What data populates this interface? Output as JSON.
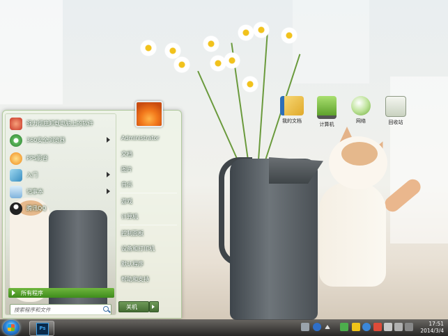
{
  "start_menu": {
    "programs": [
      {
        "label": "强力彻底卸载电脑上的软件",
        "icon": "uninstall-icon",
        "color": "#d9534f",
        "has_arrow": false
      },
      {
        "label": "360安全浏览器",
        "icon": "browser-360-icon",
        "color": "#5cb85c",
        "has_arrow": true
      },
      {
        "label": "PPS影音",
        "icon": "pps-icon",
        "color": "#f0ad4e",
        "has_arrow": false
      },
      {
        "label": "入门",
        "icon": "getting-started-icon",
        "color": "#5bc0de",
        "has_arrow": true
      },
      {
        "label": "记事本",
        "icon": "notepad-icon",
        "color": "#6fa8dc",
        "has_arrow": true
      },
      {
        "label": "腾讯QQ",
        "icon": "qq-icon",
        "color": "#333333",
        "has_arrow": false
      }
    ],
    "all_programs": "所有程序",
    "search_placeholder": "搜索程序和文件",
    "right_items": [
      {
        "label": "Administrator",
        "name": "user-account"
      },
      {
        "label": "文档",
        "name": "documents"
      },
      {
        "label": "图片",
        "name": "pictures"
      },
      {
        "label": "音乐",
        "name": "music"
      },
      {
        "label": "游戏",
        "name": "games"
      },
      {
        "label": "计算机",
        "name": "computer"
      },
      {
        "label": "控制面板",
        "name": "control-panel"
      },
      {
        "label": "设备和打印机",
        "name": "devices-printers"
      },
      {
        "label": "默认程序",
        "name": "default-programs"
      },
      {
        "label": "帮助和支持",
        "name": "help-support"
      }
    ],
    "shutdown": "关机"
  },
  "desktop_icons": [
    {
      "label": "我的文档",
      "icon": "my-documents-icon",
      "color": "#f3c54a"
    },
    {
      "label": "计算机",
      "icon": "computer-icon",
      "color": "#7fc241"
    },
    {
      "label": "网络",
      "icon": "network-icon",
      "color": "#cfe6b0"
    },
    {
      "label": "回收站",
      "icon": "recycle-bin-icon",
      "color": "#e4e9df"
    }
  ],
  "taskbar": {
    "pinned": [
      {
        "label": "Ps",
        "icon": "photoshop-icon"
      }
    ],
    "clock_time": "17:51",
    "clock_date": "2014/3/4"
  },
  "colors": {
    "accent": "#4a9a26",
    "taskbar": "#2a2a2a"
  }
}
